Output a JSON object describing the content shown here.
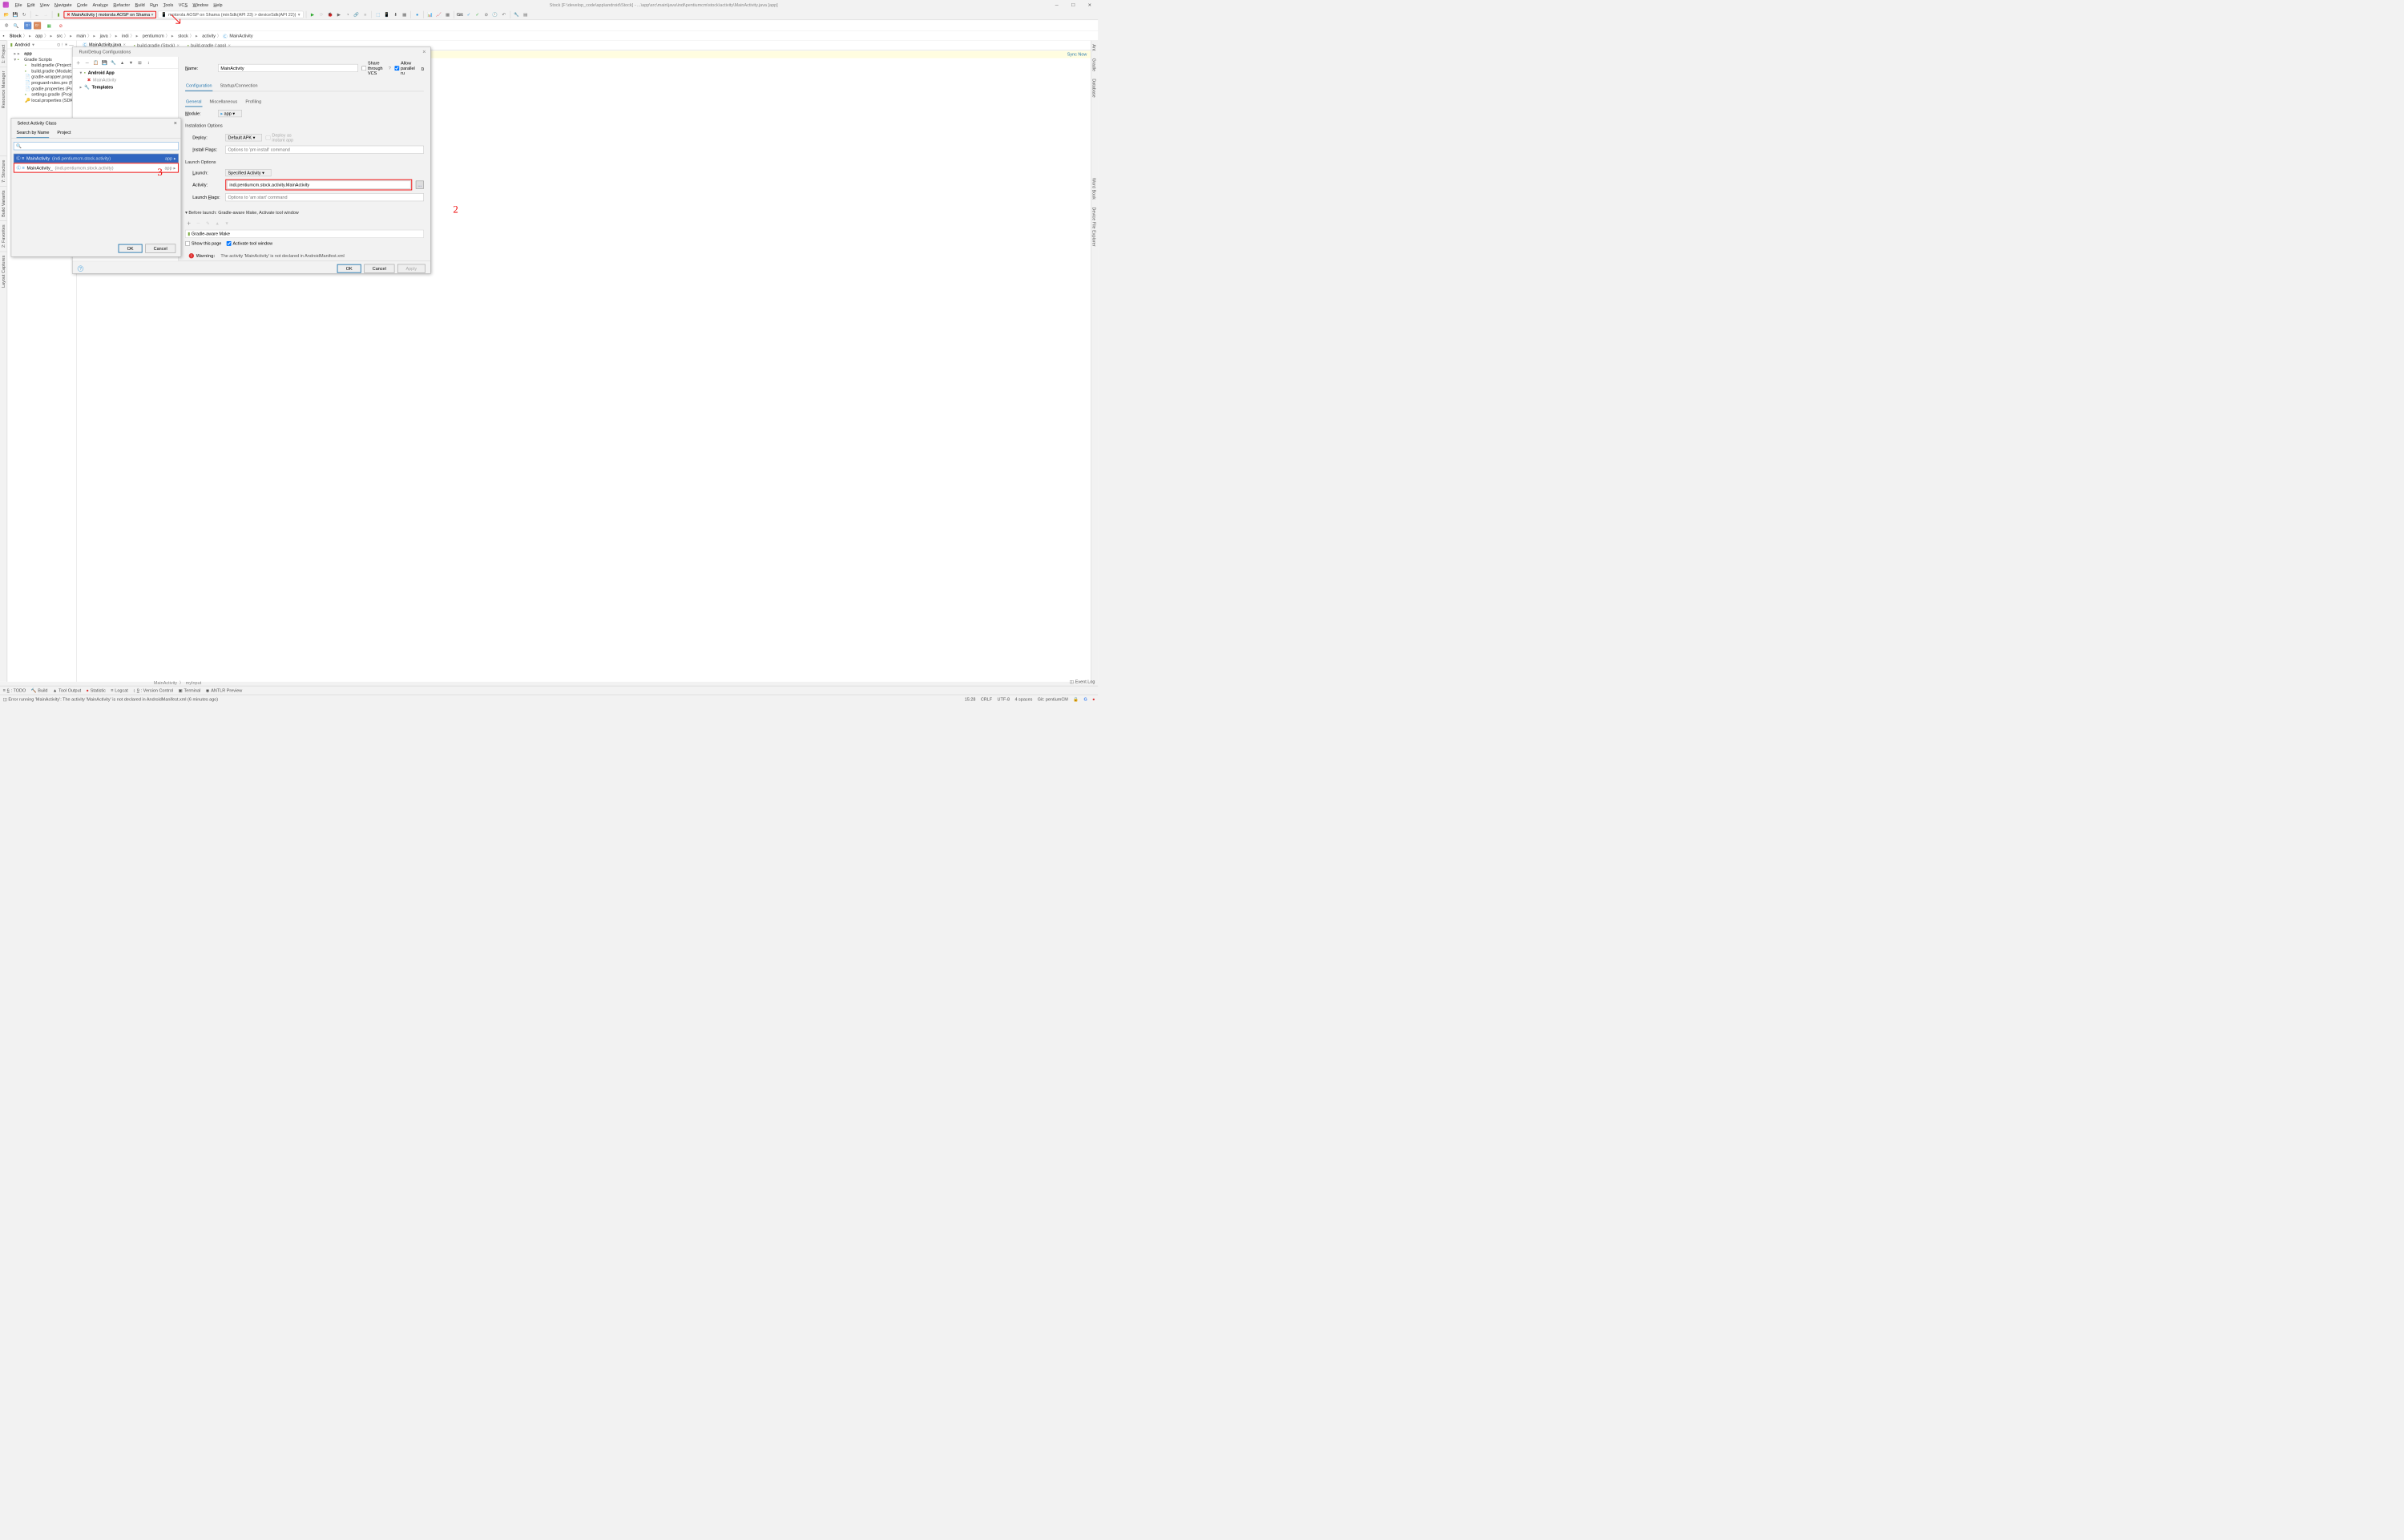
{
  "window": {
    "title": "Stock [F:\\develop_code\\app\\android\\Stock] - ...\\app\\src\\main\\java\\indi\\pentiumcm\\stock\\activity\\MainActivity.java [app]"
  },
  "menu": {
    "file": "File",
    "edit": "Edit",
    "view": "View",
    "navigate": "Navigate",
    "code": "Code",
    "analyze": "Analyze",
    "refactor": "Refactor",
    "build": "Build",
    "run": "Run",
    "tools": "Tools",
    "vcs": "VCS",
    "window": "Window",
    "help": "Help"
  },
  "toolbar": {
    "runconfig": "MainActivity | motorola AOSP on Shama",
    "device": "motorola AOSP on Shama (minSdk(API 23) > deviceSdk(API 22))",
    "gitlabel": "Git:"
  },
  "breadcrumb": [
    "Stock",
    "app",
    "src",
    "main",
    "java",
    "indi",
    "pentiumcm",
    "stock",
    "activity",
    "MainActivity"
  ],
  "projectPanel": {
    "header": "Android",
    "tree": {
      "app": "app",
      "gradlescripts": "Gradle Scripts",
      "items": [
        "build.gradle (Project: St",
        "build.gradle (Module: a",
        "gradle-wrapper.proper",
        "proguard-rules.pro (Pro",
        "gradle.properties (Proje",
        "settings.gradle (Project",
        "local.properties (SDK Lo"
      ]
    }
  },
  "tabs": [
    {
      "label": "MainActivity.java",
      "active": true
    },
    {
      "label": "build.gradle (Stock)",
      "active": false
    },
    {
      "label": "build.gradle (:app)",
      "active": false
    }
  ],
  "syncNow": "Sync Now",
  "leftTabs": [
    "1: Project",
    "Resource Manager"
  ],
  "leftTabs2": [
    "7: Structure",
    "Build Variants",
    "2: Favorites",
    "Layout Captures"
  ],
  "rightTabs": [
    "Ant",
    "Gradle",
    "Database",
    "Word Book",
    "Device File Explorer"
  ],
  "runDebug": {
    "title": "Run/Debug Configurations",
    "tree": {
      "android": "Android App",
      "main": "MainActivity",
      "templates": "Templates"
    },
    "nameLabel": "Name:",
    "nameValue": "MainActivity",
    "shareVcs": "Share through VCS",
    "allowParallel": "Allow parallel run",
    "tabs": {
      "config": "Configuration",
      "startup": "Startup/Connection"
    },
    "subtabs": {
      "general": "General",
      "misc": "Miscellaneous",
      "profiling": "Profiling"
    },
    "moduleLabel": "Module:",
    "moduleValue": "app",
    "installOptions": "Installation Options",
    "deployLabel": "Deploy:",
    "deployValue": "Default APK",
    "deployInstant": "Deploy as instant app",
    "installFlagsLabel": "Install Flags:",
    "installFlagsPh": "Options to 'pm install' command",
    "launchOptions": "Launch Options",
    "launchLabel": "Launch:",
    "launchValue": "Specified Activity",
    "activityLabel": "Activity:",
    "activityValue": "indi.pentiumcm.stock.activity.MainActivity",
    "launchFlagsLabel": "Launch Flags:",
    "launchFlagsPh": "Options to 'am start' command",
    "beforeLaunch": "Before launch: Gradle-aware Make, Activate tool window",
    "gradleMake": "Gradle-aware Make",
    "showThisPage": "Show this page",
    "activateWindow": "Activate tool window",
    "warning": "Warning:",
    "warningText": "The activity 'MainActivity' is not declared in AndroidManifest.xml",
    "ok": "OK",
    "cancel": "Cancel",
    "apply": "Apply"
  },
  "selectActivity": {
    "title": "Select Activity Class",
    "tabs": {
      "byName": "Search by Name",
      "project": "Project"
    },
    "results": [
      {
        "name": "MainActivity",
        "pkg": "(indi.pentiumcm.stock.activity)",
        "right": "app",
        "selected": true
      },
      {
        "name": "MainActivity_",
        "pkg": "(indi.pentiumcm.stock.activity)",
        "right": "app",
        "selected": false
      }
    ],
    "ok": "OK",
    "cancel": "Cancel"
  },
  "annotations": {
    "two": "2",
    "three": "3"
  },
  "nav": {
    "crumb1": "MainActivity",
    "crumb2": "myInput"
  },
  "bottomBar": {
    "todo": "6: TODO",
    "build": "Build",
    "tooloutput": "Tool Output",
    "statistic": "Statistic",
    "logcat": "Logcat",
    "vc": "9: Version Control",
    "terminal": "Terminal",
    "antlr": "ANTLR Preview",
    "eventlog": "Event Log"
  },
  "statusBar": {
    "error": "Error running 'MainActivity': The activity 'MainActivity' is not declared in AndroidManifest.xml (6 minutes ago)",
    "time": "15:28",
    "crlf": "CRLF",
    "enc": "UTF-8",
    "indent": "4 spaces",
    "git": "Git: pentiumCM"
  }
}
